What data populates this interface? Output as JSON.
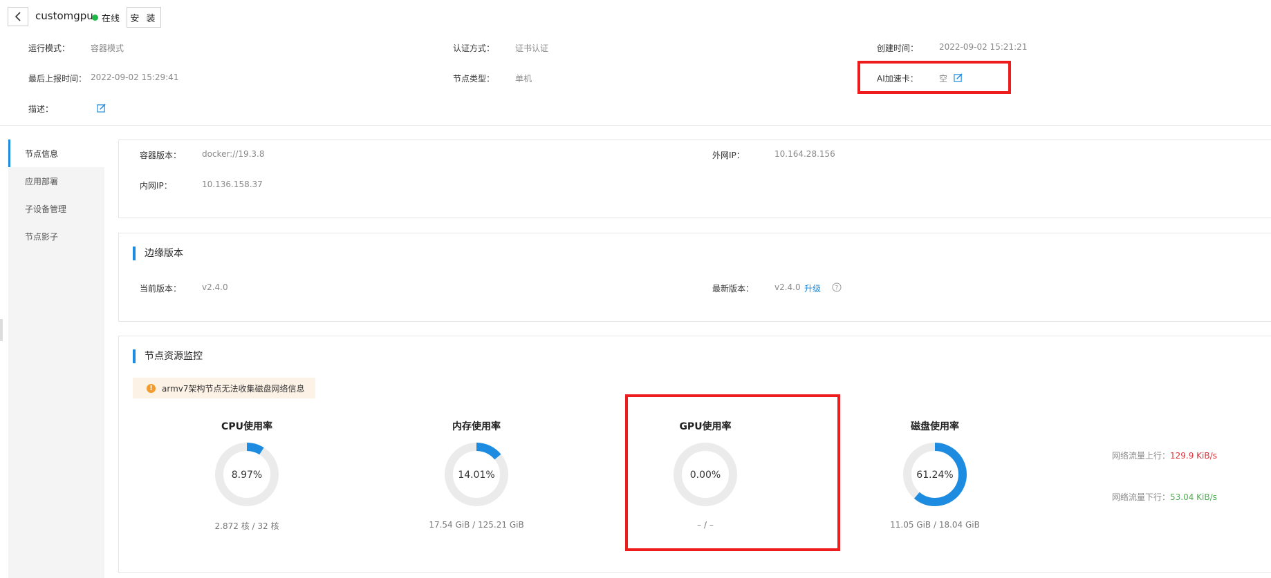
{
  "header": {
    "node_name": "customgpu",
    "status": "在线",
    "install_label": "安 装"
  },
  "meta": {
    "run_mode_k": "运行模式：",
    "run_mode_v": "容器模式",
    "auth_k": "认证方式：",
    "auth_v": "证书认证",
    "created_k": "创建时间：",
    "created_v": "2022-09-02 15:21:21",
    "last_report_k": "最后上报时间：",
    "last_report_v": "2022-09-02 15:29:41",
    "node_type_k": "节点类型：",
    "node_type_v": "单机",
    "ai_card_k": "AI加速卡：",
    "ai_card_v": "空",
    "desc_k": "描述："
  },
  "sidebar": {
    "items": [
      {
        "label": "节点信息"
      },
      {
        "label": "应用部署"
      },
      {
        "label": "子设备管理"
      },
      {
        "label": "节点影子"
      }
    ]
  },
  "node_info": {
    "container_ver_k": "容器版本：",
    "container_ver_v": "docker://19.3.8",
    "ext_ip_k": "外网IP：",
    "ext_ip_v": "10.164.28.156",
    "int_ip_k": "内网IP：",
    "int_ip_v": "10.136.158.37"
  },
  "edge_version": {
    "title": "边缘版本",
    "current_k": "当前版本：",
    "current_v": "v2.4.0",
    "latest_k": "最新版本：",
    "latest_v": "v2.4.0",
    "upgrade": "升级"
  },
  "monitor": {
    "title": "节点资源监控",
    "warning": "armv7架构节点无法收集磁盘网络信息",
    "gauges": [
      {
        "title": "CPU使用率",
        "percent": 8.97,
        "label": "8.97%",
        "foot": "2.872 核 / 32 核"
      },
      {
        "title": "内存使用率",
        "percent": 14.01,
        "label": "14.01%",
        "foot": "17.54 GiB / 125.21 GiB"
      },
      {
        "title": "GPU使用率",
        "percent": 0.0,
        "label": "0.00%",
        "foot": "– / –"
      },
      {
        "title": "磁盘使用率",
        "percent": 61.24,
        "label": "61.24%",
        "foot": "11.05 GiB / 18.04 GiB"
      }
    ],
    "net_up_k": "网络流量上行：",
    "net_up_v": "129.9 KiB/s",
    "net_down_k": "网络流量下行：",
    "net_down_v": "53.04 KiB/s"
  },
  "colors": {
    "accent": "#1d8ce0",
    "gauge_track": "#ebebeb",
    "net_up": "#e0303a",
    "net_down": "#4caf50",
    "highlight": "#ee1c1c"
  }
}
